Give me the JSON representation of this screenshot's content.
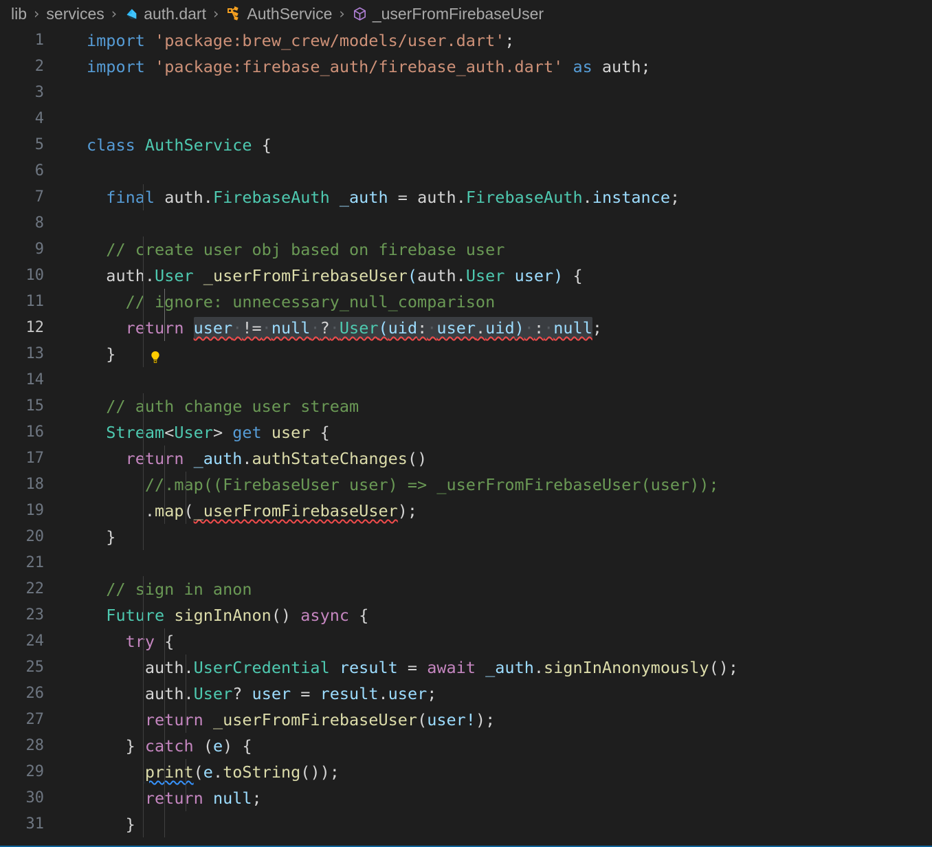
{
  "breadcrumb": {
    "items": [
      {
        "label": "lib",
        "icon": ""
      },
      {
        "label": "services",
        "icon": ""
      },
      {
        "label": "auth.dart",
        "icon": "dart-file-icon"
      },
      {
        "label": "AuthService",
        "icon": "class-icon"
      },
      {
        "label": "_userFromFirebaseUser",
        "icon": "method-icon"
      }
    ],
    "separator": "›"
  },
  "editor": {
    "language": "dart",
    "active_line": 12,
    "gutter_hint_line": 12,
    "gutter_hint_icon": "lightbulb-icon",
    "lines": [
      {
        "n": "1",
        "text": "import 'package:brew_crew/models/user.dart';"
      },
      {
        "n": "2",
        "text": "import 'package:firebase_auth/firebase_auth.dart' as auth;"
      },
      {
        "n": "3",
        "text": ""
      },
      {
        "n": "4",
        "text": ""
      },
      {
        "n": "5",
        "text": "class AuthService {"
      },
      {
        "n": "6",
        "text": ""
      },
      {
        "n": "7",
        "text": "  final auth.FirebaseAuth _auth = auth.FirebaseAuth.instance;"
      },
      {
        "n": "8",
        "text": ""
      },
      {
        "n": "9",
        "text": "  // create user obj based on firebase user"
      },
      {
        "n": "10",
        "text": "  auth.User _userFromFirebaseUser(auth.User user) {"
      },
      {
        "n": "11",
        "text": "    // ignore: unnecessary_null_comparison"
      },
      {
        "n": "12",
        "text": "    return user != null ? User(uid: user.uid) : null;"
      },
      {
        "n": "13",
        "text": "  }"
      },
      {
        "n": "14",
        "text": ""
      },
      {
        "n": "15",
        "text": "  // auth change user stream"
      },
      {
        "n": "16",
        "text": "  Stream<User> get user {"
      },
      {
        "n": "17",
        "text": "    return _auth.authStateChanges()"
      },
      {
        "n": "18",
        "text": "      //.map((FirebaseUser user) => _userFromFirebaseUser(user));"
      },
      {
        "n": "19",
        "text": "      .map(_userFromFirebaseUser);"
      },
      {
        "n": "20",
        "text": "  }"
      },
      {
        "n": "21",
        "text": ""
      },
      {
        "n": "22",
        "text": "  // sign in anon"
      },
      {
        "n": "23",
        "text": "  Future signInAnon() async {"
      },
      {
        "n": "24",
        "text": "    try {"
      },
      {
        "n": "25",
        "text": "      auth.UserCredential result = await _auth.signInAnonymously();"
      },
      {
        "n": "26",
        "text": "      auth.User? user = result.user;"
      },
      {
        "n": "27",
        "text": "      return _userFromFirebaseUser(user!);"
      },
      {
        "n": "28",
        "text": "    } catch (e) {"
      },
      {
        "n": "29",
        "text": "      print(e.toString());"
      },
      {
        "n": "30",
        "text": "      return null;"
      },
      {
        "n": "31",
        "text": "    }"
      }
    ],
    "diagnostics": [
      {
        "line": 12,
        "severity": "error",
        "text": "user != null ? User(uid: user.uid) : null"
      },
      {
        "line": 19,
        "severity": "error",
        "text": "_userFromFirebaseUser"
      },
      {
        "line": 29,
        "severity": "info",
        "text": "print"
      }
    ],
    "selection": {
      "line": 12,
      "text": "user != null ? User(uid: user.uid) : null"
    }
  },
  "colors": {
    "background": "#1e1e1e",
    "foreground": "#d4d4d4",
    "keyword": "#569cd6",
    "control": "#c586c0",
    "string": "#ce9178",
    "comment": "#6a9955",
    "type": "#4ec9b0",
    "function": "#dcdcaa",
    "variable": "#9cdcfe",
    "line_number": "#6e7681",
    "selection": "#3a3d41",
    "error_squiggle": "#f14c4c",
    "info_squiggle": "#3794ff",
    "lightbulb": "#ffcc00"
  }
}
